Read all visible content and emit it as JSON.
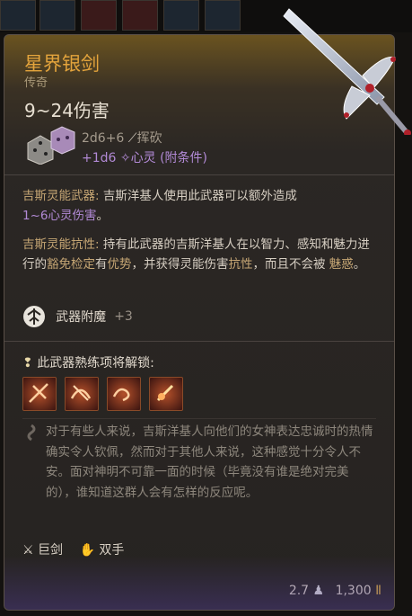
{
  "item": {
    "name": "星界银剑",
    "rarity": "传奇",
    "damage": "9~24伤害",
    "dice_main": "2d6+6",
    "damage_type": "挥砍",
    "dice_bonus": "+1d6",
    "bonus_type": "心灵 (附条件)",
    "ability1_name": "吉斯灵能武器:",
    "ability1_text": " 吉斯洋基人使用此武器可以额外造成",
    "ability1_dmg": "1~6心灵伤害",
    "ability1_end": "。",
    "ability2_name": "吉斯灵能抗性:",
    "ability2_a": " 持有此武器的吉斯洋基人在以智力、感知和魅力进行的",
    "ability2_save": "豁免检定",
    "ability2_b": "有",
    "ability2_adv": "优势",
    "ability2_c": "，并获得灵能伤害",
    "ability2_res": "抗性",
    "ability2_d": "，而且不会被 ",
    "ability2_charm": "魅惑",
    "ability2_e": "。",
    "enchant_label": "武器附魔",
    "enchant_value": "+3",
    "unlock_label": "此武器熟练项将解锁:",
    "lore": "对于有些人来说，吉斯洋基人向他们的女神表达忠诚时的热情确实令人钦佩，然而对于其他人来说，这种感觉十分令人不安。面对神明不可靠一面的时候（毕竟没有谁是绝对完美的），谁知道这群人会有怎样的反应呢。",
    "prop1": "巨剑",
    "prop2": "双手",
    "weight": "2.7",
    "price": "1,300"
  },
  "colors": {
    "title": "#e4a43c",
    "psionic": "#b28ad6",
    "keyword": "#c6a674",
    "text": "#d6cec2"
  },
  "icons": [
    "dice-icon",
    "slash-icon",
    "psychic-icon",
    "enchant-icon",
    "unlock-icon",
    "action-icon",
    "lore-icon",
    "greatsword-icon",
    "two-handed-icon",
    "weight-icon",
    "gold-icon"
  ]
}
